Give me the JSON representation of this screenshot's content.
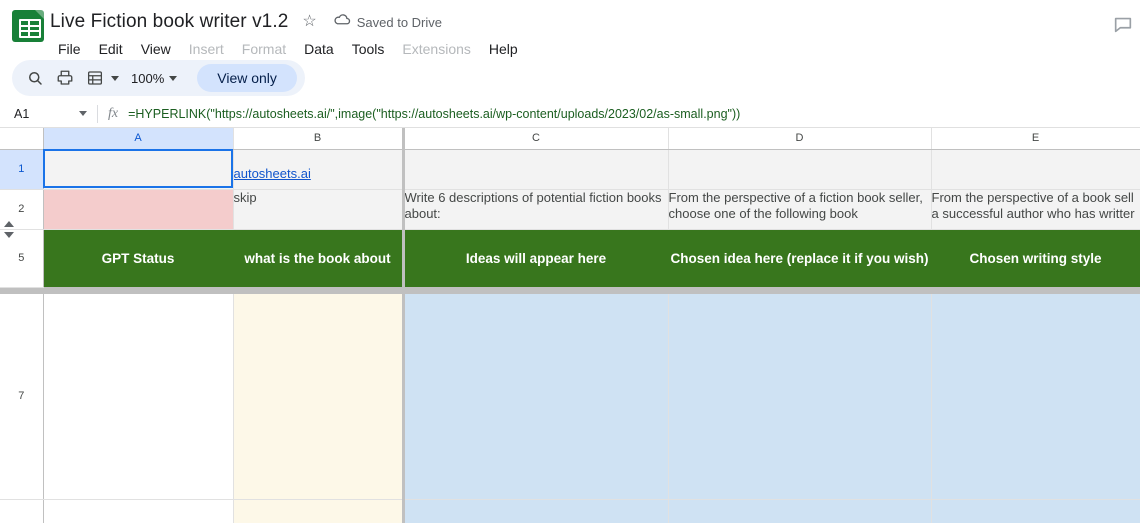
{
  "titlebar": {
    "doc_icon": "sheets-icon",
    "doc_title": "Live Fiction book writer v1.2",
    "star_glyph": "☆",
    "saved_status": "Saved to Drive",
    "menus": [
      {
        "label": "File",
        "disabled": false
      },
      {
        "label": "Edit",
        "disabled": false
      },
      {
        "label": "View",
        "disabled": false
      },
      {
        "label": "Insert",
        "disabled": true
      },
      {
        "label": "Format",
        "disabled": true
      },
      {
        "label": "Data",
        "disabled": false
      },
      {
        "label": "Tools",
        "disabled": false
      },
      {
        "label": "Extensions",
        "disabled": true
      },
      {
        "label": "Help",
        "disabled": false
      }
    ]
  },
  "toolbar": {
    "search_icon": "search-icon",
    "print_icon": "print-icon",
    "sheet_style_icon": "sheet-style-icon",
    "zoom_value": "100%",
    "view_only_label": "View only"
  },
  "formulabar": {
    "name_box_value": "A1",
    "fx_label": "fx",
    "formula": "=HYPERLINK(\"https://autosheets.ai/\",image(\"https://autosheets.ai/wp-content/uploads/2023/02/as-small.png\"))"
  },
  "grid": {
    "columns": [
      {
        "label": "A",
        "selected": true
      },
      {
        "label": "B",
        "selected": false
      },
      {
        "label": "C",
        "selected": false
      },
      {
        "label": "D",
        "selected": false
      },
      {
        "label": "E",
        "selected": false
      }
    ],
    "rows": [
      {
        "number": "1",
        "selected": true,
        "cells": [
          {
            "text": "",
            "fill": "grey"
          },
          {
            "text": "autosheets.ai",
            "fill": "grey",
            "link": true
          },
          {
            "text": "",
            "fill": "grey"
          },
          {
            "text": "",
            "fill": "grey"
          },
          {
            "text": "",
            "fill": "grey"
          }
        ]
      },
      {
        "number": "2",
        "selected": false,
        "cells": [
          {
            "text": "",
            "fill": "pink"
          },
          {
            "text": "skip",
            "fill": "grey"
          },
          {
            "text": "Write 6 descriptions of potential fiction books about:",
            "fill": "grey"
          },
          {
            "text": "From the perspective of a fiction book seller, choose one of the following book",
            "fill": "grey"
          },
          {
            "text": "From the perspective of a book sell a successful author who has writter",
            "fill": "grey"
          }
        ]
      },
      {
        "number": "5",
        "selected": false,
        "header": true,
        "cells": [
          {
            "text": "GPT Status"
          },
          {
            "text": "what is the book about"
          },
          {
            "text": "Ideas will appear here"
          },
          {
            "text": "Chosen idea here (replace it if you wish)"
          },
          {
            "text": "Chosen writing style"
          }
        ]
      },
      {
        "number": "7",
        "selected": false,
        "cells": [
          {
            "text": "",
            "fill": "white"
          },
          {
            "text": "",
            "fill": "cream"
          },
          {
            "text": "",
            "fill": "blue"
          },
          {
            "text": "",
            "fill": "blue"
          },
          {
            "text": "",
            "fill": "blue"
          }
        ]
      }
    ]
  },
  "colors": {
    "brand_green": "#188038",
    "header_green": "#38761d",
    "pink_fill": "#f4cccc",
    "cream_fill": "#fdf8e8",
    "blue_fill": "#cfe2f3",
    "selection_blue": "#1a73e8",
    "link_blue": "#1155cc",
    "formula_green": "#1b5e20"
  }
}
